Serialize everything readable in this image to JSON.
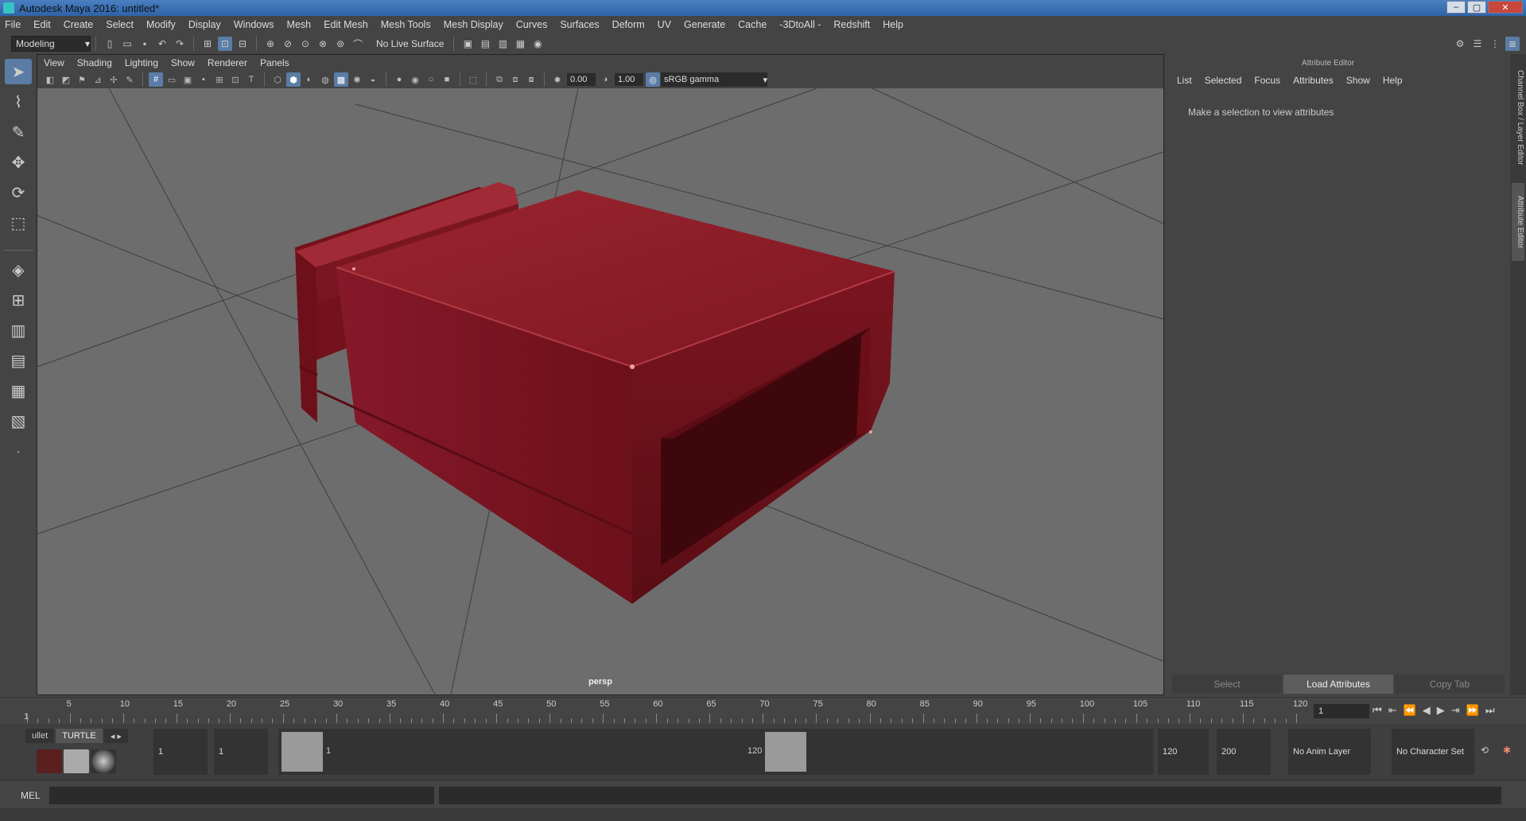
{
  "window": {
    "title": "Autodesk Maya 2016: untitled*"
  },
  "menubar": [
    "File",
    "Edit",
    "Create",
    "Select",
    "Modify",
    "Display",
    "Windows",
    "Mesh",
    "Edit Mesh",
    "Mesh Tools",
    "Mesh Display",
    "Curves",
    "Surfaces",
    "Deform",
    "UV",
    "Generate",
    "Cache",
    "-3DtoAll -",
    "Redshift",
    "Help"
  ],
  "shelf": {
    "mode": "Modeling",
    "live_surface": "No Live Surface"
  },
  "viewport": {
    "menus": [
      "View",
      "Shading",
      "Lighting",
      "Show",
      "Renderer",
      "Panels"
    ],
    "exposure": "0.00",
    "gamma": "1.00",
    "color_space": "sRGB gamma",
    "camera": "persp",
    "object_color": "#8a1a24"
  },
  "attribute_editor": {
    "title": "Attribute Editor",
    "menus": [
      "List",
      "Selected",
      "Focus",
      "Attributes",
      "Show",
      "Help"
    ],
    "message": "Make a selection to view attributes",
    "buttons": {
      "select": "Select",
      "load": "Load Attributes",
      "copy": "Copy Tab"
    }
  },
  "side_tabs": {
    "channel_box": "Channel Box / Layer Editor",
    "attribute_editor": "Attribute Editor"
  },
  "timeline": {
    "ticks": [
      "1",
      "5",
      "10",
      "15",
      "20",
      "25",
      "30",
      "35",
      "40",
      "45",
      "50",
      "55",
      "60",
      "65",
      "70",
      "75",
      "80",
      "85",
      "90",
      "95",
      "100",
      "105",
      "110",
      "115",
      "120"
    ],
    "current_frame": "1"
  },
  "range": {
    "start": "1",
    "playback_start": "1",
    "slider_start": "1",
    "slider_end": "120",
    "playback_end": "120",
    "end": "200",
    "anim_layer": "No Anim Layer",
    "character_set": "No Character Set"
  },
  "shelf_tabs": [
    "ullet",
    "TURTLE"
  ],
  "command_line": {
    "label": "MEL"
  }
}
